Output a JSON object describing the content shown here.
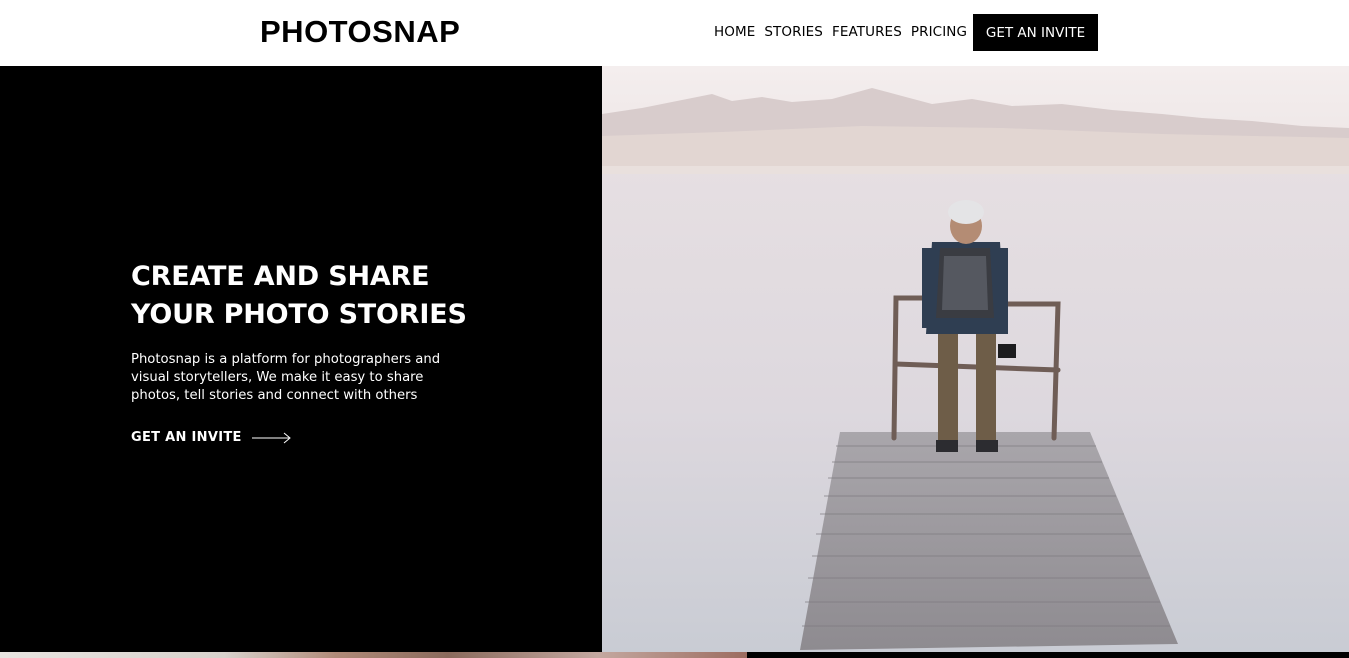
{
  "header": {
    "logo": "PHOTOSNAP",
    "nav": [
      {
        "label": "HOME"
      },
      {
        "label": "STORIES"
      },
      {
        "label": "FEATURES"
      },
      {
        "label": "PRICING"
      }
    ],
    "cta_label": "GET AN INVITE"
  },
  "hero": {
    "title_line1": "CREATE AND SHARE",
    "title_line2": "YOUR PHOTO STORIES",
    "description": "Photosnap is a platform for photographers and visual storytellers, We make it easy to share photos, tell stories and connect with others",
    "cta_label": "GET AN INVITE",
    "cta_icon": "arrow-right-icon",
    "image": "man-on-pier-lake-photo"
  },
  "colors": {
    "background": "#ffffff",
    "hero_panel": "#000000",
    "text_dark": "#000000",
    "text_light": "#ffffff"
  }
}
